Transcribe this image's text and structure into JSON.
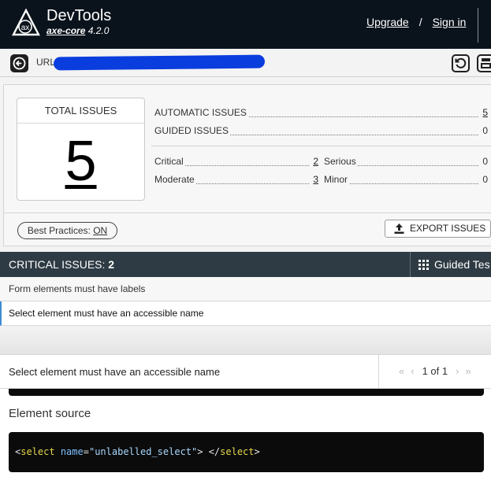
{
  "header": {
    "title": "DevTools",
    "sub_core": "axe-core",
    "sub_version": "4.2.0",
    "upgrade_label": "Upgrade",
    "separator": "/",
    "signin_label": "Sign in",
    "logo_text": "ax"
  },
  "urlbar": {
    "label": "URL"
  },
  "summary": {
    "total_label": "TOTAL ISSUES",
    "total_value": "5",
    "automatic_label": "AUTOMATIC ISSUES",
    "automatic_value": "5",
    "guided_label": "GUIDED ISSUES",
    "guided_value": "0",
    "critical_label": "Critical",
    "critical_value": "2",
    "serious_label": "Serious",
    "serious_value": "0",
    "moderate_label": "Moderate",
    "moderate_value": "3",
    "minor_label": "Minor",
    "minor_value": "0",
    "best_practices_label": "Best Practices:",
    "best_practices_value": "ON",
    "export_label": "EXPORT ISSUES"
  },
  "critical_bar": {
    "title": "CRITICAL ISSUES:",
    "count": "2",
    "guided_label": "Guided Tes"
  },
  "issues": [
    {
      "label": "Form elements must have labels"
    },
    {
      "label": "Select element must have an accessible name"
    }
  ],
  "detail": {
    "title": "Select element must have an accessible name",
    "pager_count": "1 of 1",
    "element_source_label": "Element source",
    "code_open": "<",
    "code_tag": "select",
    "code_attr": "name",
    "code_eq": "=",
    "code_value": "\"unlabelled_select\"",
    "code_mid": "> </",
    "code_close": ">"
  },
  "colors": {
    "header_bg": "#0a121b",
    "critical_bar_bg": "#2e3b44",
    "redaction": "#0a3dde",
    "selected_accent": "#3f8bd0"
  }
}
